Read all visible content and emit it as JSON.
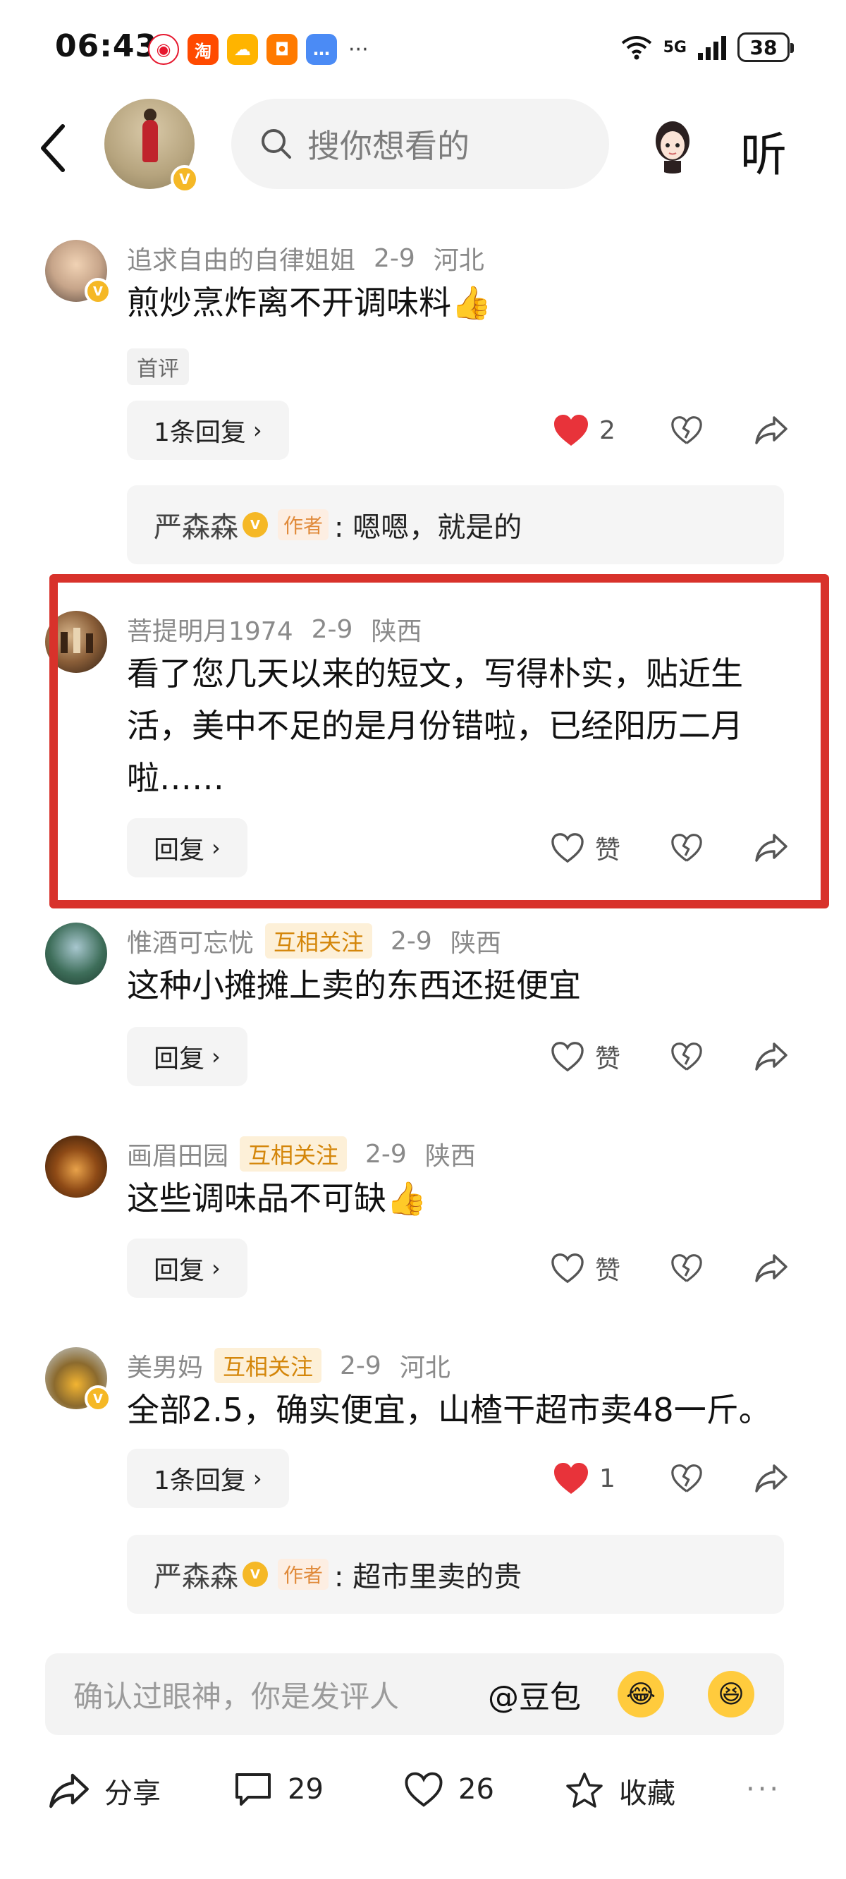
{
  "status_bar": {
    "time": "06:43",
    "taobao_label": "淘",
    "network": "5G",
    "battery": "38",
    "more": "···"
  },
  "header": {
    "search_placeholder": "搜你想看的",
    "listen_label": "听",
    "verified_mark": "V"
  },
  "comments": [
    {
      "user": "追求自由的自律姐姐",
      "date": "2-9",
      "location": "河北",
      "text": "煎炒烹炸离不开调味料👍",
      "first_tag": "首评",
      "reply_btn": "1条回复",
      "like_count": "2",
      "liked": true,
      "author_reply": {
        "name": "严森森",
        "author_tag": "作者",
        "text": ": 嗯嗯，就是的"
      }
    },
    {
      "user": "菩提明月1974",
      "date": "2-9",
      "location": "陕西",
      "text": "看了您几天以来的短文，写得朴实，贴近生活，美中不足的是月份错啦，已经阳历二月啦……",
      "reply_btn": "回复",
      "like_label": "赞",
      "liked": false
    },
    {
      "user": "惟酒可忘忧",
      "mutual_tag": "互相关注",
      "date": "2-9",
      "location": "陕西",
      "text": "这种小摊摊上卖的东西还挺便宜",
      "reply_btn": "回复",
      "like_label": "赞",
      "liked": false
    },
    {
      "user": "画眉田园",
      "mutual_tag": "互相关注",
      "date": "2-9",
      "location": "陕西",
      "text": "这些调味品不可缺👍",
      "reply_btn": "回复",
      "like_label": "赞",
      "liked": false
    },
    {
      "user": "美男妈",
      "mutual_tag": "互相关注",
      "date": "2-9",
      "location": "河北",
      "text": "全部2.5，确实便宜，山楂干超市卖48一斤。",
      "reply_btn": "1条回复",
      "like_count": "1",
      "liked": true,
      "author_reply": {
        "name": "严森森",
        "author_tag": "作者",
        "text": ": 超市里卖的贵"
      }
    }
  ],
  "input_bar": {
    "placeholder": "确认过眼神，你是发评人",
    "mention": "@豆包",
    "emoji_1": "😂",
    "emoji_2": "😆"
  },
  "bottom_bar": {
    "share_label": "分享",
    "comment_count": "29",
    "like_count": "26",
    "favorite_label": "收藏",
    "more": "···"
  },
  "colors": {
    "highlight_frame": "#d8322b",
    "like_red": "#e8333a",
    "verified_gold": "#f5b826",
    "mutual_tag_text": "#d4860a"
  }
}
